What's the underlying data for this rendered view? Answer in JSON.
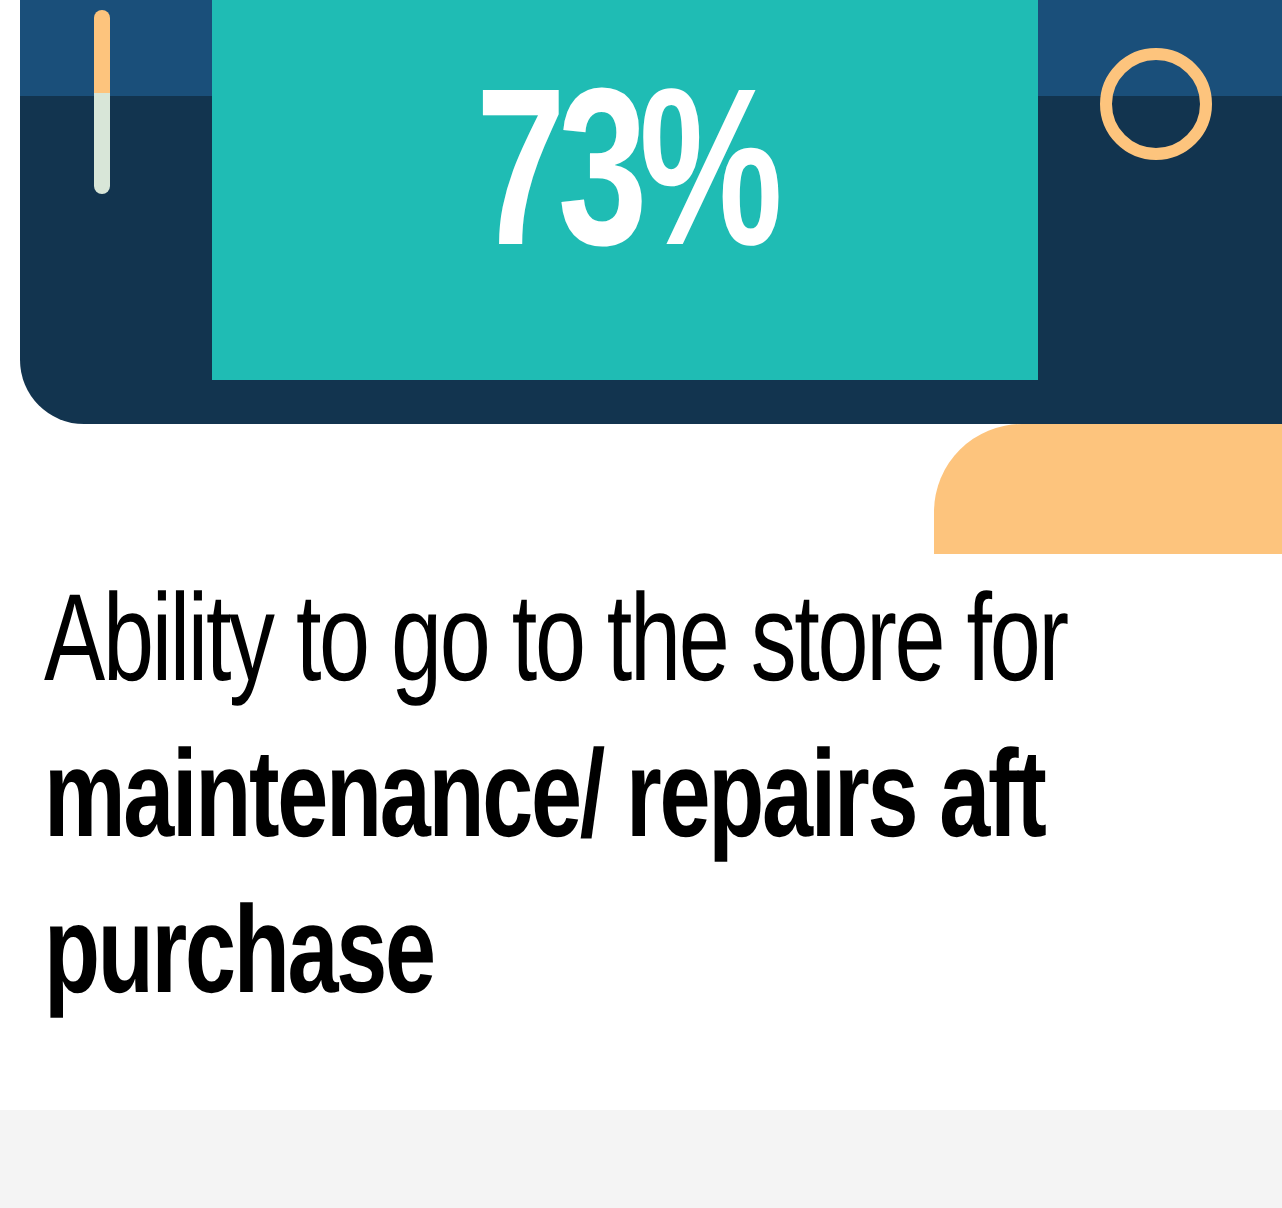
{
  "stat": {
    "value": "73%"
  },
  "caption": {
    "lines": [
      {
        "text": "Ability to go to the store for",
        "bold": false
      },
      {
        "text": "maintenance/ repairs aft",
        "bold": true
      },
      {
        "text": "purchase",
        "bold": true
      }
    ]
  }
}
